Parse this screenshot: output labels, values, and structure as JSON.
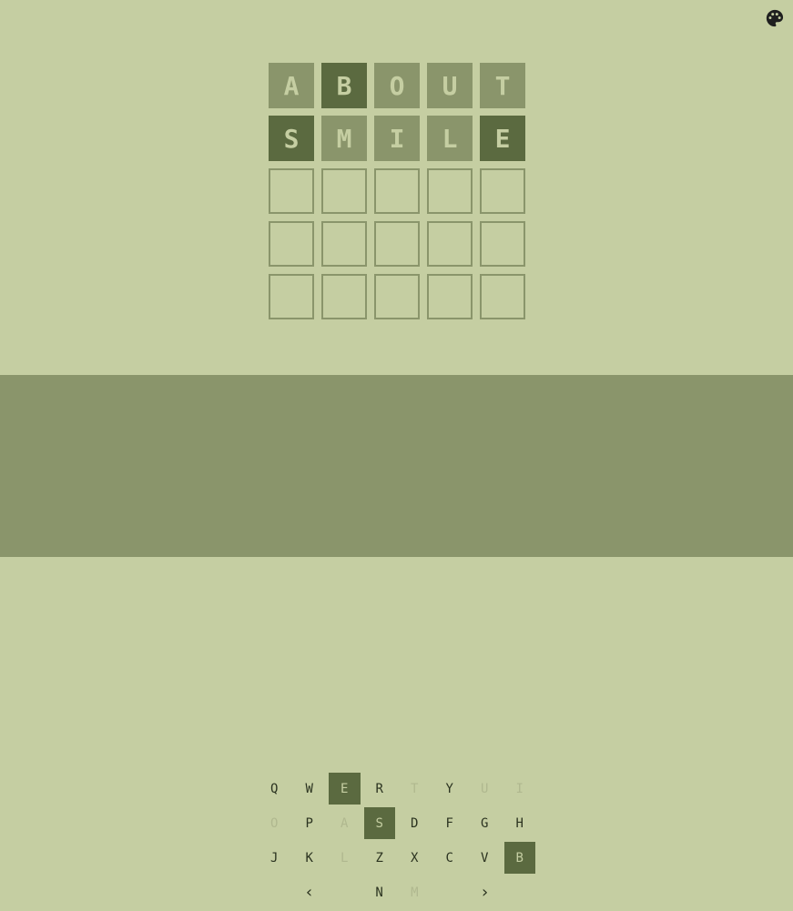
{
  "colors": {
    "background": "#c5cea2",
    "keyboard_background": "#8a956b",
    "present": "#8a956b",
    "correct": "#5b6a40",
    "icon": "#1f1f1f"
  },
  "header": {
    "icon": "palette-icon"
  },
  "board": {
    "rows": [
      [
        {
          "letter": "A",
          "state": "present"
        },
        {
          "letter": "B",
          "state": "correct"
        },
        {
          "letter": "O",
          "state": "present"
        },
        {
          "letter": "U",
          "state": "present"
        },
        {
          "letter": "T",
          "state": "present"
        }
      ],
      [
        {
          "letter": "S",
          "state": "correct"
        },
        {
          "letter": "M",
          "state": "present"
        },
        {
          "letter": "I",
          "state": "present"
        },
        {
          "letter": "L",
          "state": "present"
        },
        {
          "letter": "E",
          "state": "correct"
        }
      ],
      [
        {
          "letter": "",
          "state": "empty"
        },
        {
          "letter": "",
          "state": "empty"
        },
        {
          "letter": "",
          "state": "empty"
        },
        {
          "letter": "",
          "state": "empty"
        },
        {
          "letter": "",
          "state": "empty"
        }
      ],
      [
        {
          "letter": "",
          "state": "empty"
        },
        {
          "letter": "",
          "state": "empty"
        },
        {
          "letter": "",
          "state": "empty"
        },
        {
          "letter": "",
          "state": "empty"
        },
        {
          "letter": "",
          "state": "empty"
        }
      ],
      [
        {
          "letter": "",
          "state": "empty"
        },
        {
          "letter": "",
          "state": "empty"
        },
        {
          "letter": "",
          "state": "empty"
        },
        {
          "letter": "",
          "state": "empty"
        },
        {
          "letter": "",
          "state": "empty"
        }
      ]
    ]
  },
  "keyboard": {
    "rows": [
      [
        {
          "label": "Q",
          "state": "unused"
        },
        {
          "label": "W",
          "state": "unused"
        },
        {
          "label": "E",
          "state": "correct"
        },
        {
          "label": "R",
          "state": "unused"
        },
        {
          "label": "T",
          "state": "absent"
        },
        {
          "label": "Y",
          "state": "unused"
        },
        {
          "label": "U",
          "state": "absent"
        },
        {
          "label": "I",
          "state": "absent"
        }
      ],
      [
        {
          "label": "O",
          "state": "absent"
        },
        {
          "label": "P",
          "state": "unused"
        },
        {
          "label": "A",
          "state": "absent"
        },
        {
          "label": "S",
          "state": "correct"
        },
        {
          "label": "D",
          "state": "unused"
        },
        {
          "label": "F",
          "state": "unused"
        },
        {
          "label": "G",
          "state": "unused"
        },
        {
          "label": "H",
          "state": "unused"
        }
      ],
      [
        {
          "label": "J",
          "state": "unused"
        },
        {
          "label": "K",
          "state": "unused"
        },
        {
          "label": "L",
          "state": "absent"
        },
        {
          "label": "Z",
          "state": "unused"
        },
        {
          "label": "X",
          "state": "unused"
        },
        {
          "label": "C",
          "state": "unused"
        },
        {
          "label": "V",
          "state": "unused"
        },
        {
          "label": "B",
          "state": "correct"
        }
      ],
      [
        {
          "label": "‹",
          "state": "unused",
          "wide": true,
          "name": "backspace-key"
        },
        {
          "label": "N",
          "state": "unused"
        },
        {
          "label": "M",
          "state": "absent"
        },
        {
          "label": "›",
          "state": "unused",
          "wide": true,
          "name": "enter-key"
        }
      ]
    ]
  }
}
